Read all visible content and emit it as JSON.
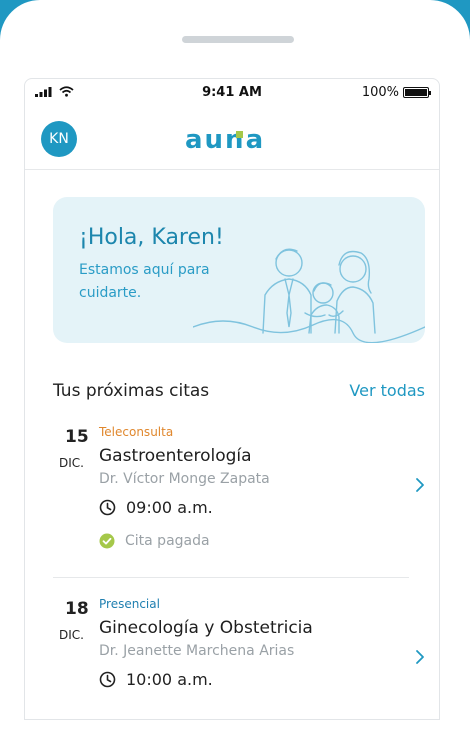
{
  "status_bar": {
    "time": "9:41 AM",
    "battery": "100%"
  },
  "header": {
    "avatar_initials": "KN",
    "logo_text": "auna"
  },
  "hero": {
    "greeting": "¡Hola, Karen!",
    "subtitle": "Estamos aquí para cuidarte."
  },
  "appointments_section": {
    "title": "Tus próximas citas",
    "see_all_label": "Ver todas"
  },
  "appointments": [
    {
      "day": "15",
      "month": "DIC.",
      "type": "Teleconsulta",
      "type_color": "#e0872d",
      "specialty": "Gastroenterología",
      "doctor": "Dr. Víctor Monge Zapata",
      "time": "09:00 a.m.",
      "status": "Cita pagada",
      "status_color": "#a5c84a"
    },
    {
      "day": "18",
      "month": "DIC.",
      "type": "Presencial",
      "type_color": "#1f7fb0",
      "specialty": "Ginecología y Obstetricia",
      "doctor": "Dr. Jeanette Marchena Arias",
      "time": "10:00 a.m."
    }
  ],
  "colors": {
    "brand": "#1f98c2",
    "hero_bg": "#e4f3f8",
    "logo_accent": "#a5c84a"
  }
}
